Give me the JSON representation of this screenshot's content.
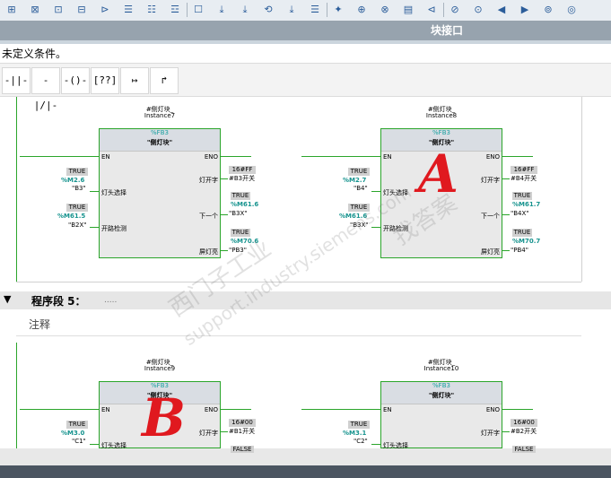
{
  "toolbar": {
    "icons": [
      "ladder-icon",
      "delete-network-icon",
      "insert-box-icon",
      "insert-box2-icon",
      "cursor-icon",
      "list-icon",
      "list2-icon",
      "list3-icon",
      "comment-icon",
      "download-icon",
      "download2-icon",
      "reset-icon",
      "download3-icon",
      "list4-icon",
      "favorite-icon",
      "compare-icon",
      "compare2-icon",
      "overview-icon",
      "filter-icon",
      "goto-icon",
      "goto2-icon",
      "back-icon",
      "fwd-icon",
      "monitor-icon",
      "glasses-icon"
    ]
  },
  "header": {
    "block_interface": "块接口"
  },
  "condition_text": "未定义条件。",
  "instructions": [
    "-||-",
    "-|/|-",
    "-()-",
    "[??]",
    "↦",
    "↱"
  ],
  "network4": {
    "fb1": {
      "instance": "#侧灯块_",
      "instance2": "Instance7",
      "type": "%FB3",
      "name": "\"侧灯块\"",
      "en": "EN",
      "eno": "ENO",
      "in1_label": "TRUE",
      "in1_addr": "%M2.6",
      "in1_sym": "\"B3\"",
      "in1_pin": "灯头选择",
      "in2_label": "TRUE",
      "in2_addr": "%M61.5",
      "in2_sym": "\"B2X\"",
      "in2_pin": "开路检测",
      "out1_pin": "灯开字",
      "out1_val": "16#FF",
      "out1_sym": "#B3开关",
      "out2_pin": "下一个",
      "out2_label": "TRUE",
      "out2_addr": "%M61.6",
      "out2_sym": "\"B3X\"",
      "out3_pin": "屏灯亮",
      "out3_label": "TRUE",
      "out3_addr": "%M70.6",
      "out3_sym": "\"PB3\""
    },
    "fb2": {
      "instance": "#侧灯块_",
      "instance2": "Instance8",
      "type": "%FB3",
      "name": "\"侧灯块\"",
      "en": "EN",
      "eno": "ENO",
      "in1_label": "TRUE",
      "in1_addr": "%M2.7",
      "in1_sym": "\"B4\"",
      "in1_pin": "灯头选择",
      "in2_label": "TRUE",
      "in2_addr": "%M61.6",
      "in2_sym": "\"B3X\"",
      "in2_pin": "开路检测",
      "out1_pin": "灯开字",
      "out1_val": "16#FF",
      "out1_sym": "#B4开关",
      "out2_pin": "下一个",
      "out2_label": "TRUE",
      "out2_addr": "%M61.7",
      "out2_sym": "\"B4X\"",
      "out3_pin": "屏灯亮",
      "out3_label": "TRUE",
      "out3_addr": "%M70.7",
      "out3_sym": "\"PB4\""
    }
  },
  "network5": {
    "title": "程序段 5：",
    "dots": ".....",
    "comment": "注释",
    "fb1": {
      "instance": "#侧灯块_",
      "instance2": "Instance9",
      "type": "%FB3",
      "name": "\"侧灯块\"",
      "en": "EN",
      "eno": "ENO",
      "in1_label": "TRUE",
      "in1_addr": "%M3.0",
      "in1_sym": "\"C1\"",
      "in1_pin": "灯头选择",
      "out1_pin": "灯开字",
      "out1_val": "16#00",
      "out1_sym": "#B1开关",
      "out2_label": "FALSE"
    },
    "fb2": {
      "instance": "#侧灯块_",
      "instance2": "Instance10",
      "type": "%FB3",
      "name": "\"侧灯块\"",
      "en": "EN",
      "eno": "ENO",
      "in1_label": "TRUE",
      "in1_addr": "%M3.1",
      "in1_sym": "\"C2\"",
      "in1_pin": "灯头选择",
      "out1_pin": "灯开字",
      "out1_val": "16#00",
      "out1_sym": "#B2开关",
      "out2_label": "FALSE"
    }
  },
  "annotations": {
    "hand_a": "A",
    "hand_b": "B"
  },
  "watermark": {
    "line1": "西门子工业",
    "line2": "support.industry.siemens.com",
    "line3": "找答案"
  },
  "colors": {
    "wire": "#2ba52b",
    "address": "#16938e",
    "handwriting": "#e0191f"
  }
}
